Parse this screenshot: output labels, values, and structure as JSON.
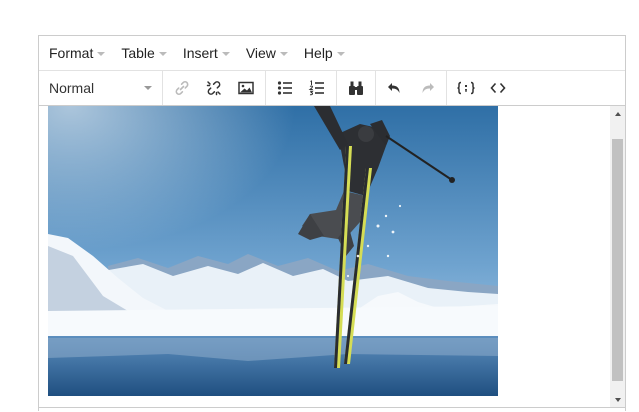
{
  "menubar": {
    "items": [
      {
        "label": "Format"
      },
      {
        "label": "Table"
      },
      {
        "label": "Insert"
      },
      {
        "label": "View"
      },
      {
        "label": "Help"
      }
    ]
  },
  "toolbar": {
    "format_select": {
      "value": "Normal"
    },
    "buttons": [
      "link-icon",
      "unlink-icon",
      "image-icon",
      "bulleted-list-icon",
      "numbered-list-icon",
      "find-icon",
      "undo-icon",
      "redo-icon",
      "code-block-icon",
      "source-code-icon"
    ]
  },
  "content": {
    "image_subject": "skier-jumping-over-snowy-mountains"
  },
  "colors": {
    "border": "#cccccc",
    "text": "#333333",
    "icon_dark": "#333333",
    "icon_disabled": "#bbbbbb"
  }
}
